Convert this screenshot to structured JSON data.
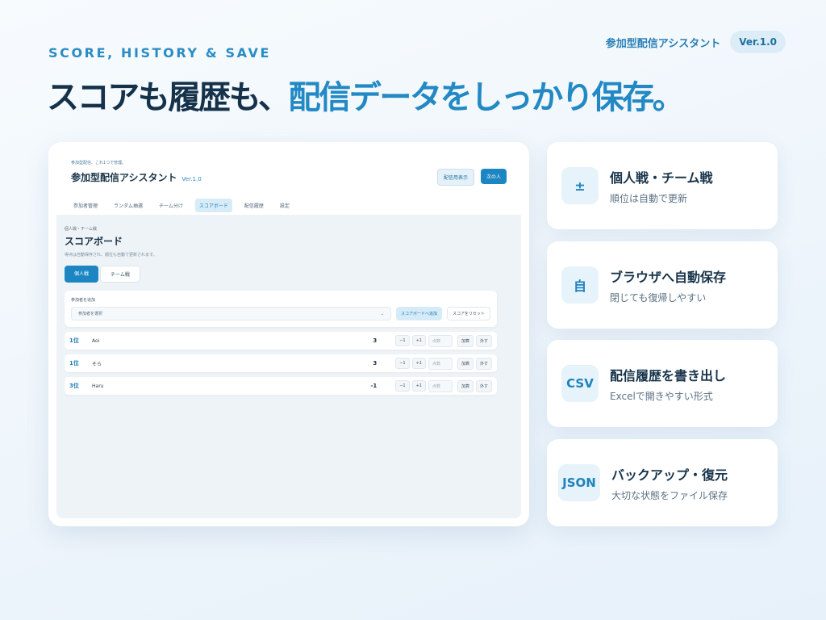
{
  "eyebrow": "SCORE, HISTORY & SAVE",
  "brand": {
    "name": "参加型配信アシスタント",
    "version": "Ver.1.0"
  },
  "headline": {
    "part1": "スコアも履歴も、",
    "part2": "配信データをしっかり保存。"
  },
  "app": {
    "tagline": "参加型配信、これ1つで管理。",
    "title": "参加型配信アシスタント",
    "version": "Ver.1.0",
    "stream_display_button": "配信用表示",
    "next_person_button": "次の人",
    "tabs": [
      "参加者管理",
      "ランダム抽選",
      "チーム分け",
      "スコアボード",
      "配信履歴",
      "設定"
    ],
    "active_tab": "スコアボード",
    "section": {
      "tag": "個人戦・チーム戦",
      "title": "スコアボード",
      "subtitle": "得点は自動保存され、順位も自動で更新されます。"
    },
    "mode_tabs": {
      "individual": "個人戦",
      "team": "チーム戦"
    },
    "add_card": {
      "label": "参加者を追加",
      "select_placeholder": "参加者を選択",
      "add_button": "スコアボードへ追加",
      "reset_button": "スコアをリセット"
    },
    "rows": [
      {
        "rank": "1位",
        "name": "Aoi",
        "score": "3"
      },
      {
        "rank": "1位",
        "name": "そら",
        "score": "3"
      },
      {
        "rank": "3位",
        "name": "Haru",
        "score": "-1"
      }
    ],
    "row_controls": {
      "minus": "−1",
      "plus": "+1",
      "points_placeholder": "点数",
      "add": "加算",
      "remove": "外す"
    }
  },
  "features": [
    {
      "icon": "±",
      "icon_name": "plus-minus-icon",
      "title": "個人戦・チーム戦",
      "subtitle": "順位は自動で更新"
    },
    {
      "icon": "自",
      "icon_name": "auto-save-icon",
      "title": "ブラウザへ自動保存",
      "subtitle": "閉じても復帰しやすい"
    },
    {
      "icon": "CSV",
      "icon_name": "csv-icon",
      "title": "配信履歴を書き出し",
      "subtitle": "Excelで開きやすい形式"
    },
    {
      "icon": "JSON",
      "icon_name": "json-icon",
      "title": "バックアップ・復元",
      "subtitle": "大切な状態をファイル保存"
    }
  ],
  "colors": {
    "accent": "#2289c4",
    "dark": "#15324a",
    "background": "#eef5fb"
  }
}
